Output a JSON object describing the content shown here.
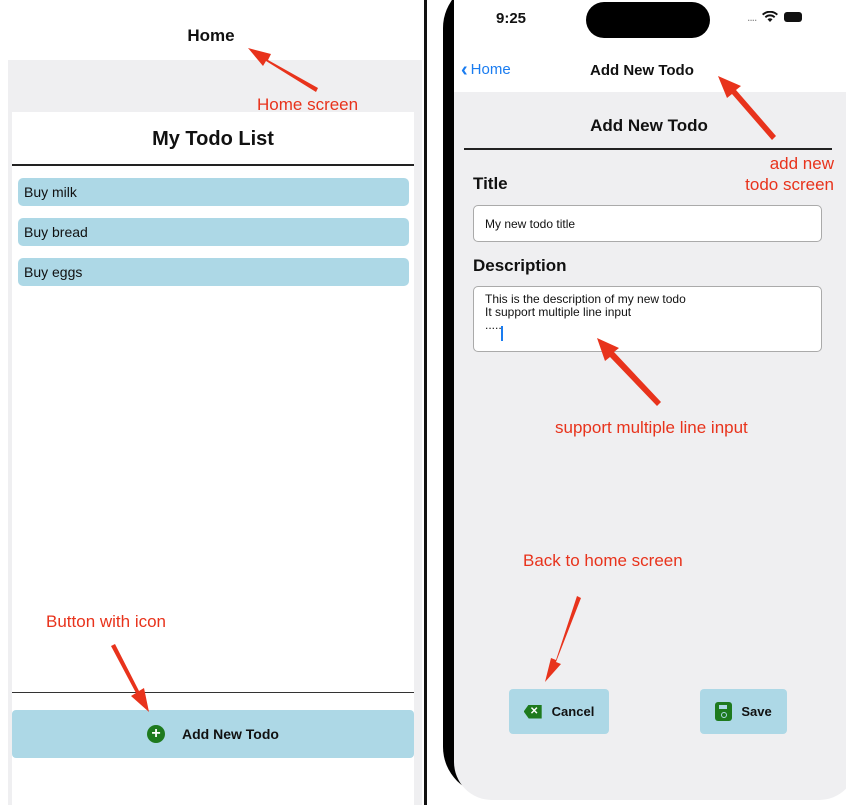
{
  "left": {
    "nav_title": "Home",
    "list_title": "My Todo List",
    "todos": [
      "Buy milk",
      "Buy bread",
      "Buy eggs"
    ],
    "add_button_label": "Add New Todo"
  },
  "right": {
    "status_time": "9:25",
    "status_dots": "....",
    "back_label": "Home",
    "nav_title": "Add New Todo",
    "form_title": "Add New Todo",
    "title_label": "Title",
    "title_value": "My new todo title",
    "description_label": "Description",
    "description_value": "This is the description of my new todo\nIt support multiple line input\n.....",
    "cancel_label": "Cancel",
    "save_label": "Save"
  },
  "annotations": {
    "home_screen": "Home screen",
    "add_new_line1": "add new",
    "add_new_line2": "todo screen",
    "multi_line": "support multiple line input",
    "back_to_home": "Back to home screen",
    "button_with_icon": "Button with icon"
  },
  "icons": {
    "add": "plus-circle-icon",
    "back": "chevron-left-icon",
    "cancel": "backspace-x-icon",
    "save": "floppy-disk-icon"
  },
  "colors": {
    "accent_blue": "#1a7cf0",
    "button_bg": "#add8e6",
    "icon_green": "#1e7a1e",
    "annotation_red": "#e8331c"
  }
}
